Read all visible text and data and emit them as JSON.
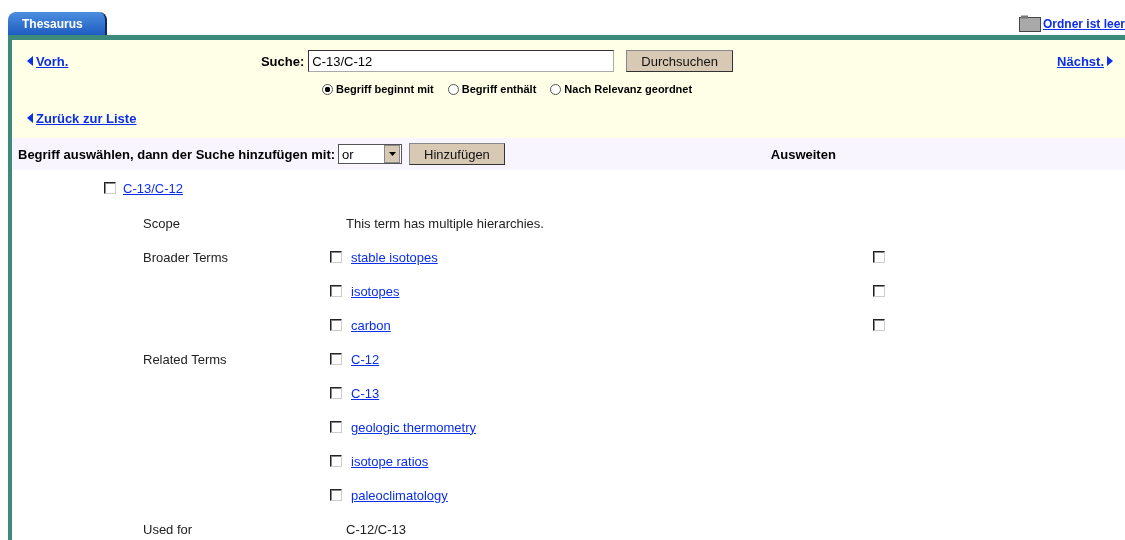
{
  "tab": {
    "label": "Thesaurus",
    "selected": true
  },
  "folder_link": "Ordner ist leer",
  "search": {
    "prev": "Vorh.",
    "next": "Nächst.",
    "label": "Suche:",
    "value": "C-13/C-12",
    "button": "Durchsuchen",
    "options": [
      {
        "label": "Begriff beginnt mit",
        "selected": true
      },
      {
        "label": "Begriff enthält",
        "selected": false
      },
      {
        "label": "Nach Relevanz geordnet",
        "selected": false
      }
    ],
    "back_link": "Zurück zur Liste"
  },
  "add_bar": {
    "label": "Begriff auswählen, dann der Suche hinzufügen mit:",
    "operator": "or",
    "button": "Hinzufügen",
    "expand_heading": "Ausweiten"
  },
  "main_term": {
    "label": "C-13/C-12",
    "checked": false
  },
  "sections": [
    {
      "kind": "text",
      "label": "Scope",
      "text": "This term has multiple hierarchies."
    },
    {
      "kind": "terms",
      "label": "Broader Terms",
      "terms": [
        {
          "label": "stable isotopes",
          "checked": false,
          "expand_checked": false
        },
        {
          "label": "isotopes",
          "checked": false,
          "expand_checked": false
        },
        {
          "label": "carbon",
          "checked": false,
          "expand_checked": false
        }
      ]
    },
    {
      "kind": "terms",
      "label": "Related Terms",
      "terms": [
        {
          "label": "C-12",
          "checked": false
        },
        {
          "label": "C-13",
          "checked": false
        },
        {
          "label": "geologic thermometry",
          "checked": false
        },
        {
          "label": "isotope ratios",
          "checked": false
        },
        {
          "label": "paleoclimatology",
          "checked": false
        }
      ]
    },
    {
      "kind": "text",
      "label": "Used for",
      "text": "C-12/C-13"
    }
  ]
}
